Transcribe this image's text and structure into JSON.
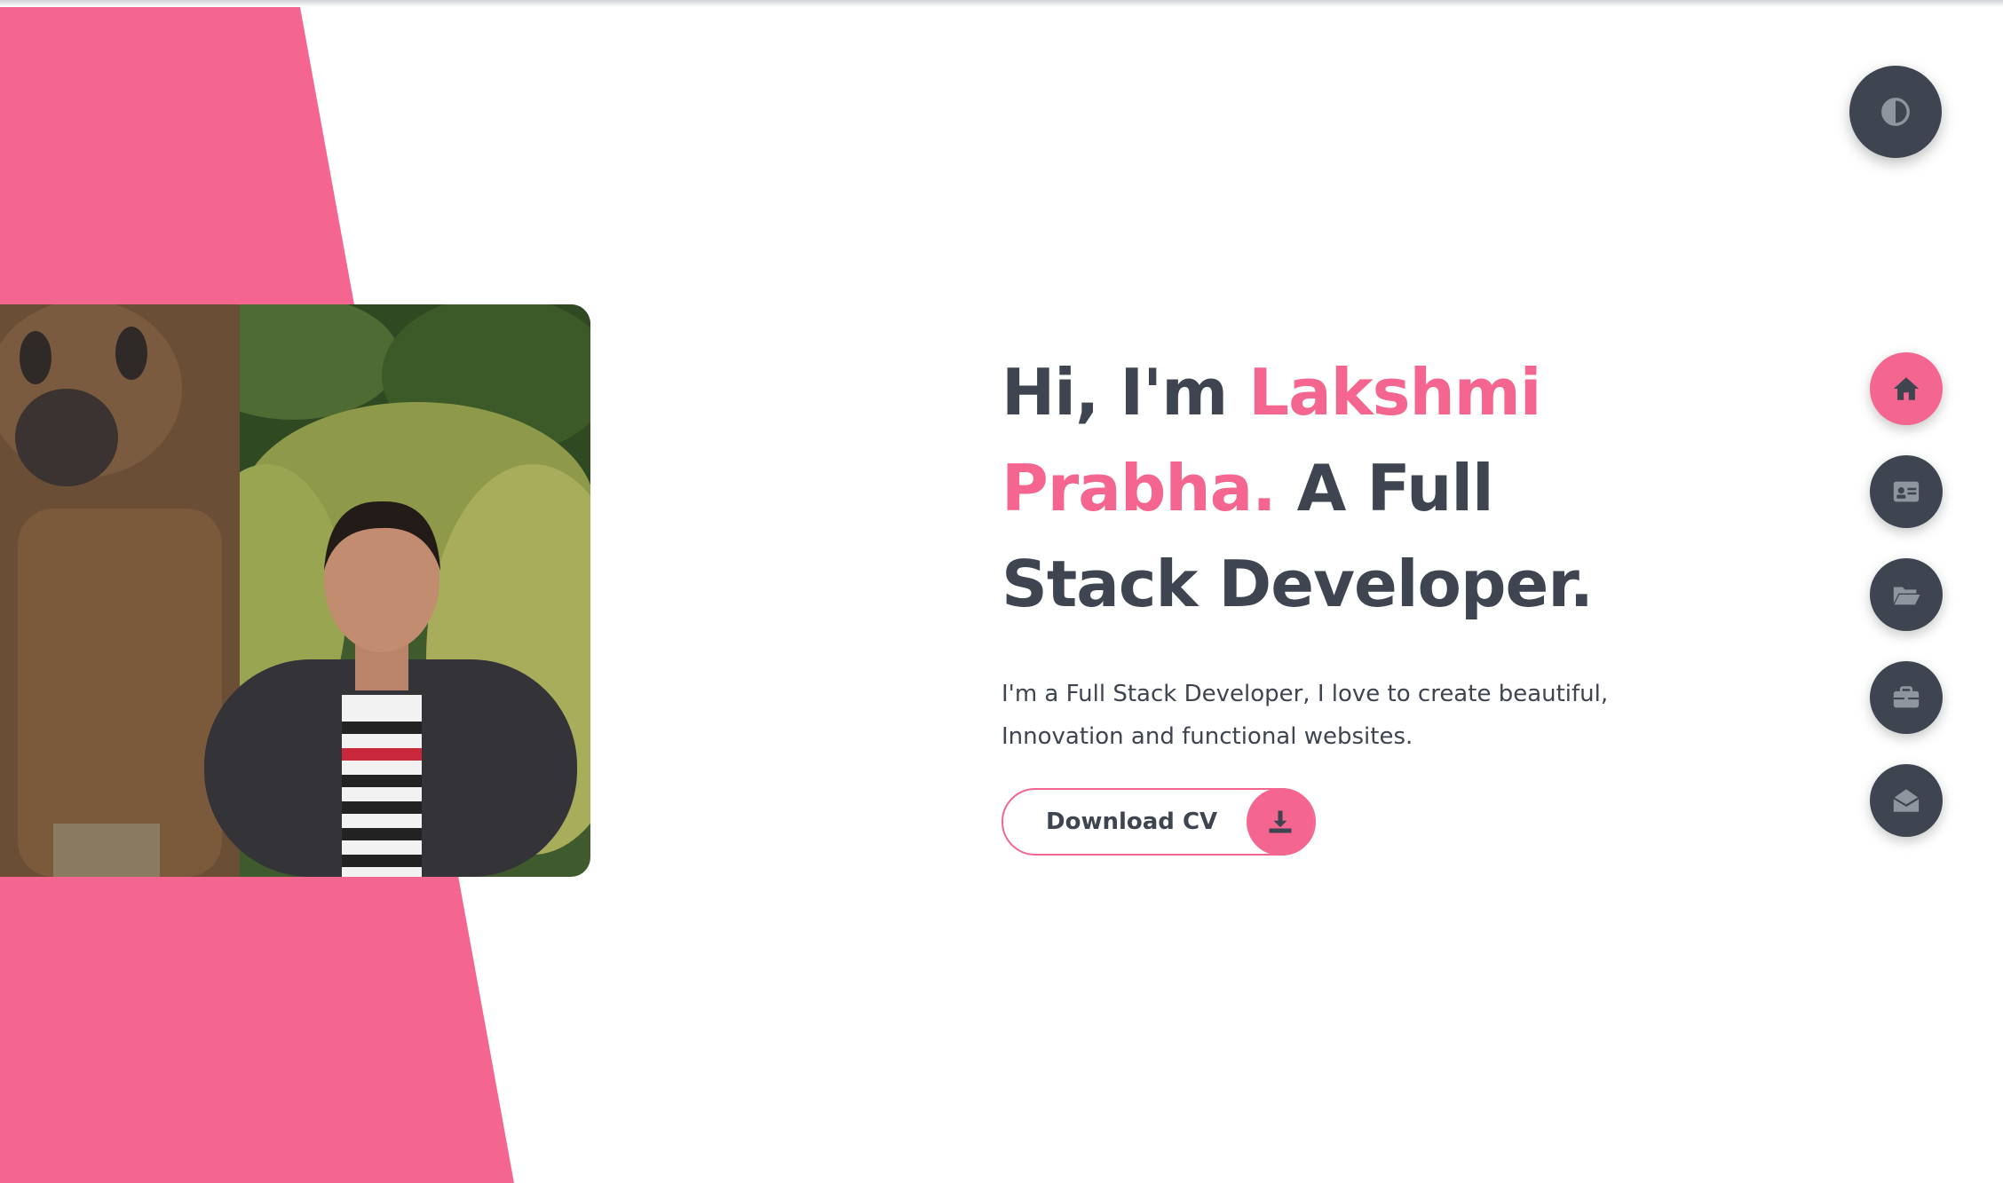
{
  "colors": {
    "accent": "#f4658f",
    "dark": "#3e4550",
    "background": "#ffffff"
  },
  "hero": {
    "greeting": "Hi, I'm ",
    "name": "Lakshmi Prabha.",
    "role": " A Full Stack Developer.",
    "description": "I'm a Full Stack Developer, I love to create beautiful, Innovation and functional websites.",
    "download_label": "Download CV"
  },
  "theme_toggle": {
    "icon": "contrast-icon"
  },
  "nav": [
    {
      "id": "home",
      "icon": "home-icon",
      "active": true
    },
    {
      "id": "about",
      "icon": "id-card-icon",
      "active": false
    },
    {
      "id": "portfolio",
      "icon": "folder-open-icon",
      "active": false
    },
    {
      "id": "experience",
      "icon": "briefcase-icon",
      "active": false
    },
    {
      "id": "contact",
      "icon": "envelope-open-icon",
      "active": false
    }
  ]
}
